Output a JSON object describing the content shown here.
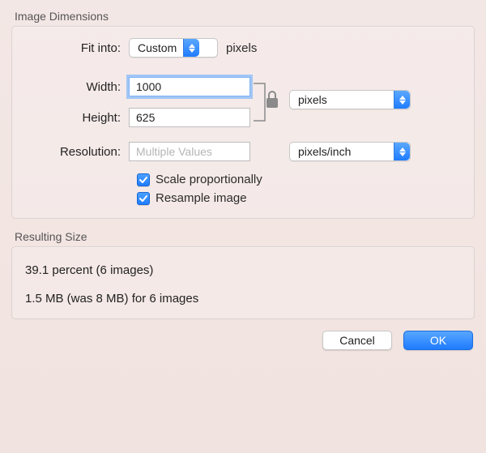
{
  "sections": {
    "image_dimensions_title": "Image Dimensions",
    "resulting_size_title": "Resulting Size"
  },
  "labels": {
    "fit_into": "Fit into:",
    "width": "Width:",
    "height": "Height:",
    "resolution": "Resolution:"
  },
  "fit_into": {
    "selected": "Custom",
    "unit_label": "pixels"
  },
  "width": {
    "value": "1000"
  },
  "height": {
    "value": "625"
  },
  "size_unit": {
    "selected": "pixels"
  },
  "resolution": {
    "placeholder": "Multiple Values",
    "value": "",
    "unit_selected": "pixels/inch"
  },
  "checks": {
    "scale_proportionally": {
      "checked": true,
      "label": "Scale proportionally"
    },
    "resample_image": {
      "checked": true,
      "label": "Resample image"
    }
  },
  "result": {
    "percent_line": "39.1 percent (6 images)",
    "size_line": "1.5 MB (was 8 MB) for 6 images"
  },
  "buttons": {
    "cancel": "Cancel",
    "ok": "OK"
  }
}
